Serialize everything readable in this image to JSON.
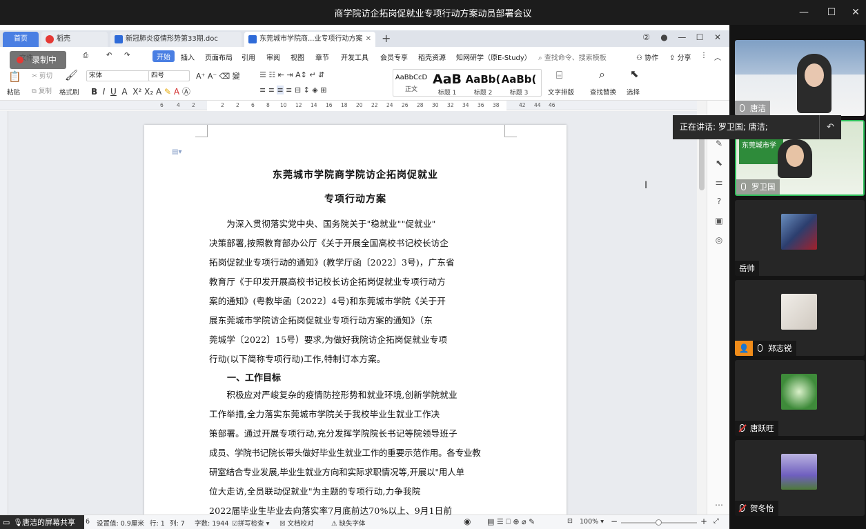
{
  "meeting": {
    "title": "商学院访企拓岗促就业专项行动方案动员部署会议",
    "recording_label": "录制中",
    "speaking_label": "正在讲话: 罗卫国; 唐洁;",
    "share_label": "唐洁的屏幕共享"
  },
  "wps": {
    "tabs": [
      {
        "label": "首页"
      },
      {
        "label": "稻壳"
      },
      {
        "label": "新冠肺炎疫情形势第33期.doc"
      },
      {
        "label": "东莞城市学院商...业专项行动方案"
      }
    ],
    "menu": [
      "文件",
      "开始",
      "插入",
      "页面布局",
      "引用",
      "审阅",
      "视图",
      "章节",
      "开发工具",
      "会员专享",
      "稻壳资源",
      "知网研学（原E-Study）"
    ],
    "search_placeholder": "查找命令、搜索模板",
    "collab_label": "协作",
    "share_label": "分享",
    "ribbon": {
      "paste": "粘贴",
      "cut": "剪切",
      "copy": "复制",
      "format_painter": "格式刷",
      "font_name": "宋体",
      "font_size": "四号",
      "styles": [
        {
          "preview": "AaBbCcD",
          "label": "正文"
        },
        {
          "preview": "AaB",
          "label": "标题 1"
        },
        {
          "preview": "AaBb(",
          "label": "标题 2"
        },
        {
          "preview": "AaBb(",
          "label": "标题 3"
        }
      ],
      "text_layout": "文字排版",
      "find_replace": "查找替换",
      "select": "选择"
    },
    "ruler_ticks": [
      "6",
      "4",
      "2",
      "2",
      "2",
      "4",
      "6",
      "8",
      "10",
      "12",
      "14",
      "16",
      "18",
      "20",
      "22",
      "24",
      "26",
      "28",
      "30",
      "32",
      "34",
      "36",
      "38",
      "42",
      "44",
      "46"
    ],
    "vruler_ticks": [
      "2",
      "4",
      "6",
      "8",
      "10",
      "12",
      "14",
      "16",
      "18",
      "20",
      "22",
      "24",
      "26",
      "28",
      "30",
      "32",
      "34",
      "36",
      "38",
      "40",
      "42",
      "44",
      "46",
      "48"
    ],
    "document": {
      "title_line1": "东莞城市学院商学院访企拓岗促就业",
      "title_line2": "专项行动方案",
      "paragraph1": [
        "　　为深入贯彻落实党中央、国务院关于\"稳就业\"\"促就业\"",
        "决策部署,按照教育部办公厅《关于开展全国高校书记校长访企",
        "拓岗促就业专项行动的通知》(教学厅函〔2022〕3号)，广东省",
        "教育厅《于印发开展高校书记校长访企拓岗促就业专项行动方",
        "案的通知》(粤教毕函〔2022〕4号)和东莞城市学院《关于开",
        "展东莞城市学院访企拓岗促就业专项行动方案的通知》（东",
        "莞城学〔2022〕15号）要求,为做好我院访企拓岗促就业专项",
        "行动(以下简称专项行动)工作,特制订本方案。"
      ],
      "heading1": "一、工作目标",
      "paragraph2": [
        "　　积极应对严峻复杂的疫情防控形势和就业环境,创新学院就业",
        "工作举措,全力落实东莞城市学院关于我校毕业生就业工作决",
        "策部署。通过开展专项行动,充分发挥学院院长书记等院领导班子",
        "成员、学院书记院长带头做好毕业生就业工作的重要示范作用。各专业教",
        "研室结合专业发展,毕业生就业方向和实际求职情况等,开展以\"用人单",
        "位大走访,全员联动促就业\"为主题的专项行动,力争我院",
        "2022届毕业生毕业去向落实率7月底前达70%以上、9月1日前"
      ]
    },
    "status": {
      "page": "6",
      "setting": "设置值: 0.9厘米",
      "row": "行: 1",
      "col": "列: 7",
      "word_count": "字数: 1944",
      "spell_check": "拼写检查",
      "doc_check": "文档校对",
      "missing_font": "缺失字体",
      "zoom": "100%"
    }
  },
  "participants": [
    {
      "name": "唐洁",
      "muted": false,
      "type": "video"
    },
    {
      "name": "罗卫国",
      "muted": false,
      "type": "video",
      "active": true
    },
    {
      "name": "岳帅",
      "muted": false,
      "type": "avatar",
      "no_mic": true
    },
    {
      "name": "郑志锐",
      "muted": false,
      "type": "avatar"
    },
    {
      "name": "唐跃旺",
      "muted": true,
      "type": "avatar"
    },
    {
      "name": "贺冬怡",
      "muted": true,
      "type": "avatar"
    }
  ],
  "colors": {
    "accent": "#4a7fe3",
    "active_speaker": "#2fbf5b",
    "record": "#e53935"
  }
}
